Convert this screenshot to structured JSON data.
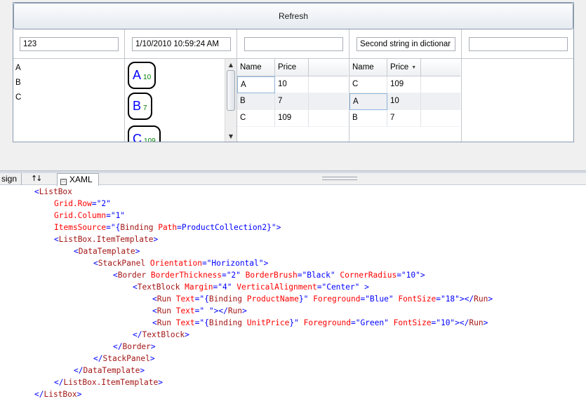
{
  "designer": {
    "refresh_label": "Refresh",
    "textboxes": [
      "123",
      "1/10/2010 10:59:24 AM",
      "",
      "Second string in dictionar",
      ""
    ],
    "letters": [
      "A",
      "B",
      "C"
    ],
    "products": [
      {
        "name": "A",
        "price": "10"
      },
      {
        "name": "B",
        "price": "7"
      },
      {
        "name": "C",
        "price": "109"
      }
    ],
    "grid1": {
      "headers": [
        "Name",
        "Price"
      ],
      "rows": [
        [
          "A",
          "10"
        ],
        [
          "B",
          "7"
        ],
        [
          "C",
          "109"
        ]
      ]
    },
    "grid2": {
      "headers": [
        "Name",
        "Price"
      ],
      "sort_indicator": "▼",
      "rows": [
        [
          "C",
          "109"
        ],
        [
          "A",
          "10"
        ],
        [
          "B",
          "7"
        ]
      ]
    }
  },
  "tabs": {
    "design": "sign",
    "swap_icon": "↑↓",
    "xaml": "XAML"
  },
  "code_lines": [
    {
      "i": 0,
      "t": [
        [
          "b",
          "<"
        ],
        [
          "m",
          "ListBox"
        ]
      ]
    },
    {
      "i": 1,
      "t": [
        [
          "a",
          "Grid.Row"
        ],
        [
          "b",
          "=\"2\""
        ]
      ]
    },
    {
      "i": 1,
      "t": [
        [
          "a",
          "Grid.Column"
        ],
        [
          "b",
          "=\"1\""
        ]
      ]
    },
    {
      "i": 1,
      "t": [
        [
          "a",
          "ItemsSource"
        ],
        [
          "b",
          "=\"{"
        ],
        [
          "m",
          "Binding"
        ],
        [
          "a",
          " Path"
        ],
        [
          "b",
          "=ProductCollection2}\">"
        ]
      ]
    },
    {
      "i": 1,
      "t": [
        [
          "b",
          "<"
        ],
        [
          "m",
          "ListBox.ItemTemplate"
        ],
        [
          "b",
          ">"
        ]
      ]
    },
    {
      "i": 2,
      "t": [
        [
          "b",
          "<"
        ],
        [
          "m",
          "DataTemplate"
        ],
        [
          "b",
          ">"
        ]
      ]
    },
    {
      "i": 3,
      "t": [
        [
          "b",
          "<"
        ],
        [
          "m",
          "StackPanel"
        ],
        [
          "a",
          " Orientation"
        ],
        [
          "b",
          "=\"Horizontal\">"
        ]
      ]
    },
    {
      "i": 4,
      "t": [
        [
          "b",
          "<"
        ],
        [
          "m",
          "Border"
        ],
        [
          "a",
          " BorderThickness"
        ],
        [
          "b",
          "=\"2\""
        ],
        [
          "a",
          " BorderBrush"
        ],
        [
          "b",
          "=\"Black\""
        ],
        [
          "a",
          " CornerRadius"
        ],
        [
          "b",
          "=\"10\">"
        ]
      ]
    },
    {
      "i": 5,
      "t": [
        [
          "b",
          "<"
        ],
        [
          "m",
          "TextBlock"
        ],
        [
          "a",
          " Margin"
        ],
        [
          "b",
          "=\"4\""
        ],
        [
          "a",
          " VerticalAlignment"
        ],
        [
          "b",
          "=\"Center\" >"
        ]
      ]
    },
    {
      "i": 6,
      "t": [
        [
          "b",
          "<"
        ],
        [
          "m",
          "Run"
        ],
        [
          "a",
          " Text"
        ],
        [
          "b",
          "=\"{"
        ],
        [
          "m",
          "Binding"
        ],
        [
          "a",
          " ProductName"
        ],
        [
          "b",
          "}\""
        ],
        [
          "a",
          " Foreground"
        ],
        [
          "b",
          "=\"Blue\""
        ],
        [
          "a",
          " FontSize"
        ],
        [
          "b",
          "=\"18\"></"
        ],
        [
          "m",
          "Run"
        ],
        [
          "b",
          ">"
        ]
      ]
    },
    {
      "i": 6,
      "t": [
        [
          "b",
          "<"
        ],
        [
          "m",
          "Run"
        ],
        [
          "a",
          " Text"
        ],
        [
          "b",
          "=\" \"></"
        ],
        [
          "m",
          "Run"
        ],
        [
          "b",
          ">"
        ]
      ]
    },
    {
      "i": 6,
      "t": [
        [
          "b",
          "<"
        ],
        [
          "m",
          "Run"
        ],
        [
          "a",
          " Text"
        ],
        [
          "b",
          "=\"{"
        ],
        [
          "m",
          "Binding"
        ],
        [
          "a",
          " UnitPrice"
        ],
        [
          "b",
          "}\""
        ],
        [
          "a",
          " Foreground"
        ],
        [
          "b",
          "=\"Green\""
        ],
        [
          "a",
          " FontSize"
        ],
        [
          "b",
          "=\"10\"></"
        ],
        [
          "m",
          "Run"
        ],
        [
          "b",
          ">"
        ]
      ]
    },
    {
      "i": 5,
      "t": [
        [
          "b",
          "</"
        ],
        [
          "m",
          "TextBlock"
        ],
        [
          "b",
          ">"
        ]
      ]
    },
    {
      "i": 4,
      "t": [
        [
          "b",
          "</"
        ],
        [
          "m",
          "Border"
        ],
        [
          "b",
          ">"
        ]
      ]
    },
    {
      "i": 3,
      "t": [
        [
          "b",
          "</"
        ],
        [
          "m",
          "StackPanel"
        ],
        [
          "b",
          ">"
        ]
      ]
    },
    {
      "i": 2,
      "t": [
        [
          "b",
          "</"
        ],
        [
          "m",
          "DataTemplate"
        ],
        [
          "b",
          ">"
        ]
      ]
    },
    {
      "i": 1,
      "t": [
        [
          "b",
          "</"
        ],
        [
          "m",
          "ListBox.ItemTemplate"
        ],
        [
          "b",
          ">"
        ]
      ]
    },
    {
      "i": 0,
      "t": [
        [
          "b",
          "</"
        ],
        [
          "m",
          "ListBox"
        ],
        [
          "b",
          ">"
        ]
      ]
    }
  ],
  "colors": {
    "tag_blue": "#0000ff",
    "element_maroon": "#a31515",
    "attribute_red": "#ff0000",
    "product_name": "#0000ff",
    "product_price": "#008000"
  }
}
